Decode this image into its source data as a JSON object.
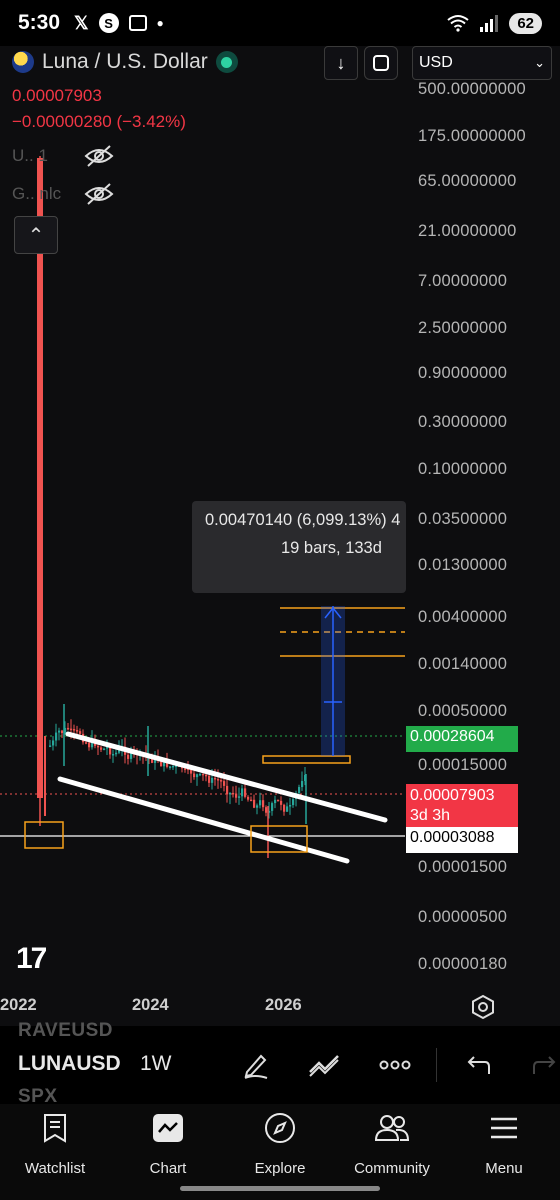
{
  "status_bar": {
    "time": "5:30",
    "notification_icons": [
      "x-icon",
      "s-icon",
      "screenshot-icon",
      "dot-icon"
    ],
    "signal_label": "5",
    "battery": "62"
  },
  "chart": {
    "symbol_title": "Luna / U.S. Dollar",
    "last_price": "0.00007903",
    "change": "−0.00000280 (−3.42%)",
    "indicators": [
      {
        "label": "U.. 1",
        "visible": false
      },
      {
        "label": "G.. nlc",
        "visible": false
      }
    ],
    "currency": "USD",
    "price_axis": [
      "500.00000000",
      "175.00000000",
      "65.00000000",
      "21.00000000",
      "7.00000000",
      "2.50000000",
      "0.90000000",
      "0.30000000",
      "0.10000000",
      "0.03500000",
      "0.01300000",
      "0.00400000",
      "0.00140000",
      "0.00050000",
      "0.00015000",
      "0.00001500",
      "0.00000500",
      "0.00000180"
    ],
    "price_tags": {
      "level_green": "0.00028604",
      "last_price": "0.00007903",
      "countdown": "3d 3h",
      "level_white": "0.00003088"
    },
    "measure_tooltip": {
      "line1": "0.00470140 (6,099.13%) 4",
      "line2": "19 bars, 133d"
    },
    "time_axis": [
      "2022",
      "2024",
      "2026"
    ],
    "colors": {
      "up": "#26a69a",
      "down": "#ef5350",
      "channel": "#ffffff",
      "box": "#f7a21b",
      "measure": "#2962ff",
      "tag_green": "#22ab4a",
      "tag_red": "#f23645"
    }
  },
  "toolbar": {
    "ghost_symbols": [
      "RAVEUSD",
      "SPX"
    ],
    "active_symbol": "LUNAUSD",
    "interval": "1W",
    "tools": [
      "pencil-icon",
      "trend-lines-icon",
      "more-icon",
      "undo-icon",
      "redo-icon"
    ]
  },
  "nav": {
    "items": [
      {
        "label": "Watchlist",
        "icon": "watchlist-icon"
      },
      {
        "label": "Chart",
        "icon": "chart-icon"
      },
      {
        "label": "Explore",
        "icon": "compass-icon"
      },
      {
        "label": "Community",
        "icon": "community-icon"
      },
      {
        "label": "Menu",
        "icon": "menu-icon"
      }
    ]
  }
}
